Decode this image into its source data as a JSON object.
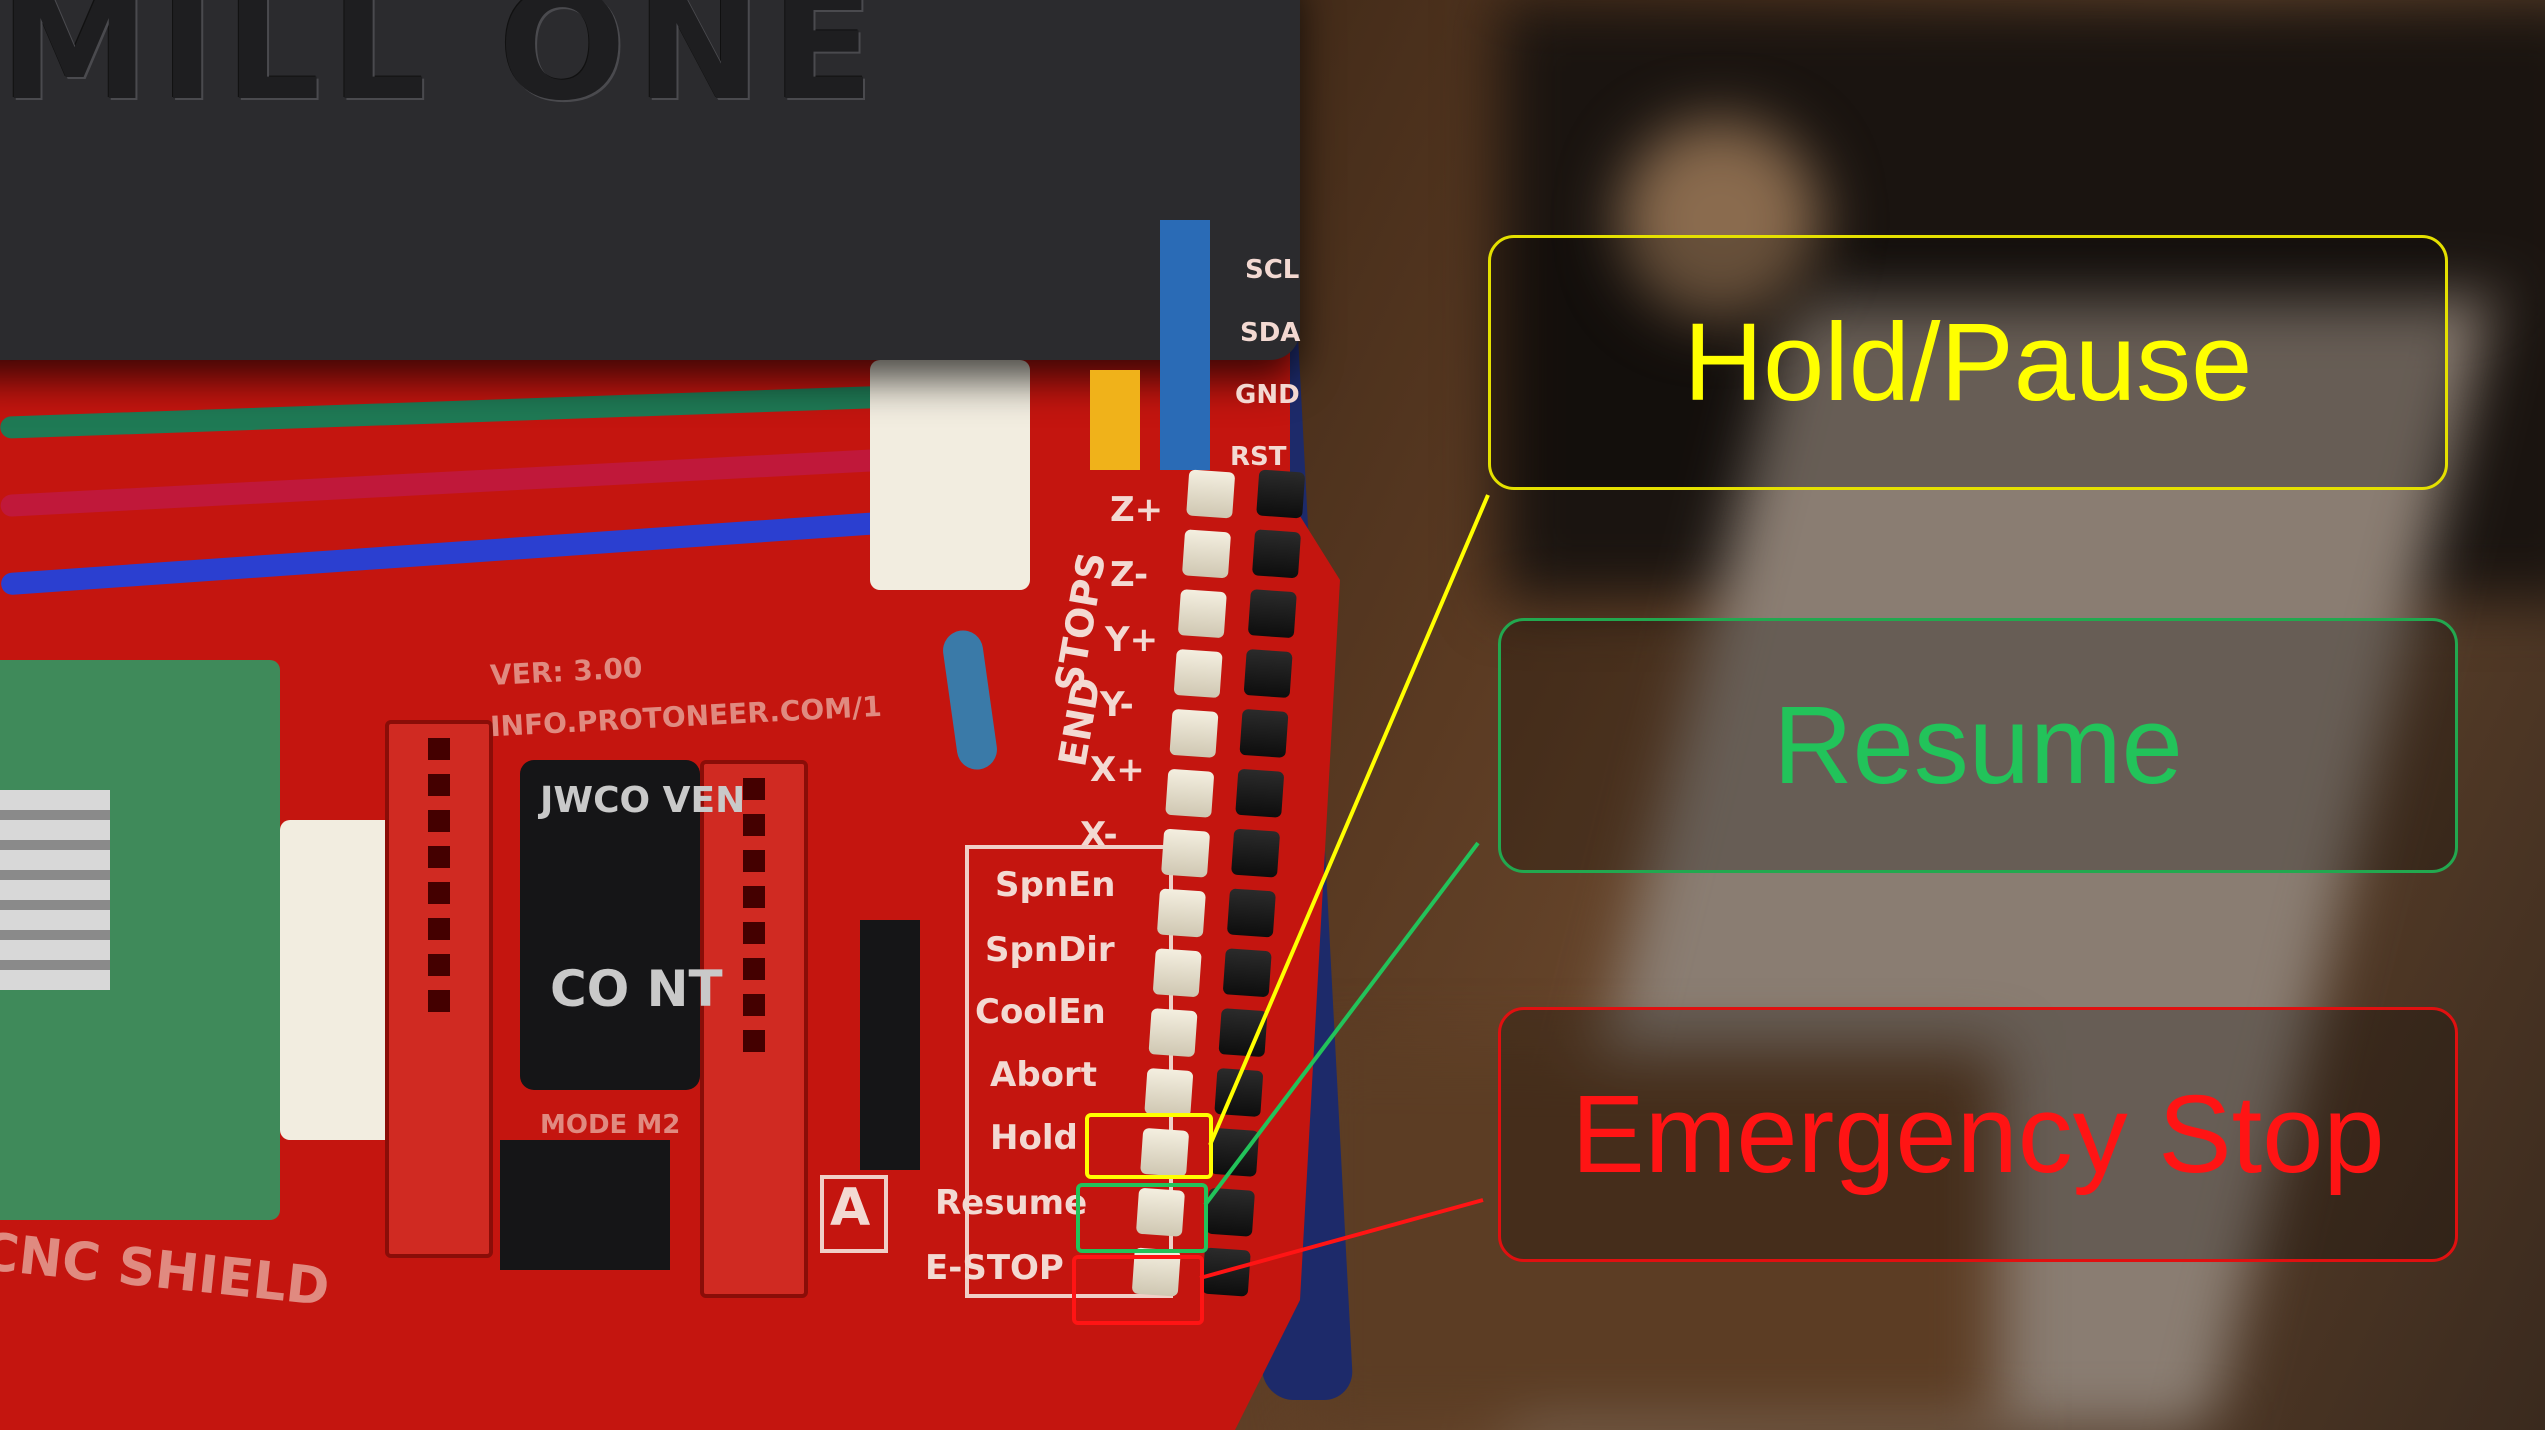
{
  "photo": {
    "lid_text": "MILL ONE",
    "silkscreen": {
      "pin_labels": [
        "SCL",
        "SDA",
        "GND",
        "RST",
        "Z+",
        "Z-",
        "Y+",
        "Y-",
        "X+",
        "X-"
      ],
      "stops_label": "STOPS",
      "end_label": "END",
      "version": "VER: 3.00",
      "website": "INFO.PROTONEER.COM/1",
      "function_labels": [
        "SpnEn",
        "SpnDir",
        "CoolEn",
        "Abort",
        "Hold",
        "Resume",
        "E-STOP"
      ],
      "a_label": "A",
      "board_name": "CNC SHIELD",
      "jumper_label": "MODE M2",
      "cap_text": "JWCO VEN",
      "cap_text2": "CO NT"
    }
  },
  "callouts": [
    {
      "id": "hold",
      "label": "Hold/Pause",
      "color": "#ffff00"
    },
    {
      "id": "resume",
      "label": "Resume",
      "color": "#22c35a"
    },
    {
      "id": "estop",
      "label": "Emergency Stop",
      "color": "#ff1414"
    }
  ]
}
